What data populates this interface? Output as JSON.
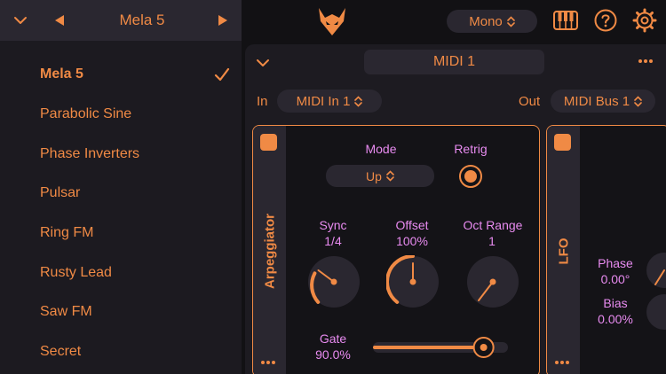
{
  "preset_header": {
    "title": "Mela 5",
    "collapse_icon": "chevron-down-icon",
    "prev_icon": "triangle-left-icon",
    "next_icon": "triangle-right-icon"
  },
  "presets": [
    {
      "label": "Mela 5",
      "selected": true
    },
    {
      "label": "Parabolic Sine",
      "selected": false
    },
    {
      "label": "Phase Inverters",
      "selected": false
    },
    {
      "label": "Pulsar",
      "selected": false
    },
    {
      "label": "Ring FM",
      "selected": false
    },
    {
      "label": "Rusty Lead",
      "selected": false
    },
    {
      "label": "Saw FM",
      "selected": false
    },
    {
      "label": "Secret",
      "selected": false
    }
  ],
  "topbar": {
    "logo_icon": "fox-logo-icon",
    "voice_mode": "Mono",
    "keyboard_icon": "piano-keyboard-icon",
    "help_icon": "help-circle-icon",
    "settings_icon": "gear-icon"
  },
  "midi_panel": {
    "title": "MIDI 1",
    "in_label": "In",
    "in_value": "MIDI In 1",
    "out_label": "Out",
    "out_value": "MIDI Bus 1"
  },
  "arpeggiator": {
    "name": "Arpeggiator",
    "enabled": true,
    "mode_label": "Mode",
    "mode_value": "Up",
    "retrig_label": "Retrig",
    "retrig_on": true,
    "sync_label": "Sync",
    "sync_value": "1/4",
    "offset_label": "Offset",
    "offset_value": "100%",
    "oct_range_label": "Oct Range",
    "oct_range_value": "1",
    "gate_label": "Gate",
    "gate_value": "90.0%",
    "gate_fraction": 0.82
  },
  "lfo": {
    "name": "LFO",
    "enabled": true,
    "phase_label": "Phase",
    "phase_value": "0.00°",
    "bias_label": "Bias",
    "bias_value": "0.00%"
  },
  "colors": {
    "accent": "#f08a45",
    "param_label": "#e88bf0",
    "panel": "#1d1b21",
    "control_bg": "#2a2730",
    "background": "#121114"
  }
}
